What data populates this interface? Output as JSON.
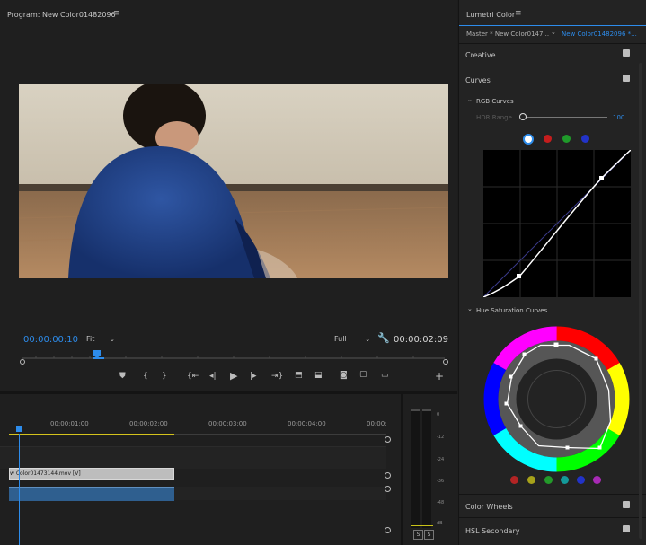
{
  "program": {
    "title": "Program: New Color01482096",
    "timecode_current": "00:00:00:10",
    "fit_label": "Fit",
    "quality_label": "Full",
    "timecode_duration": "00:00:02:09"
  },
  "timeline": {
    "ruler_labels": [
      "00:00:01:00",
      "00:00:02:00",
      "00:00:03:00",
      "00:00:04:00",
      "00:00:"
    ],
    "clip_label": "w Color01473144.mov [V]"
  },
  "meter": {
    "db_labels": [
      "0",
      "-12",
      "-24",
      "-36",
      "-48",
      "dB"
    ],
    "solo_left": "S",
    "solo_right": "S"
  },
  "lumetri": {
    "title": "Lumetri Color",
    "master_label": "Master * New Color0147...",
    "clip_label": "New Color01482096 *...",
    "sections": {
      "creative": "Creative",
      "curves": "Curves",
      "rgb_curves": "RGB Curves",
      "hdr_range": "HDR Range",
      "hdr_value": "100",
      "hue_sat": "Hue Saturation Curves",
      "color_wheels": "Color Wheels",
      "hsl_secondary": "HSL Secondary"
    },
    "channel_colors": [
      "#ffffff",
      "#c51d1d",
      "#1f9a2a",
      "#2233c8"
    ],
    "hue_dot_colors": [
      "#b32424",
      "#a7a21a",
      "#239a2a",
      "#139a9a",
      "#2233c8",
      "#a72ab5"
    ]
  },
  "colors": {
    "accent": "#2d8ceb"
  }
}
